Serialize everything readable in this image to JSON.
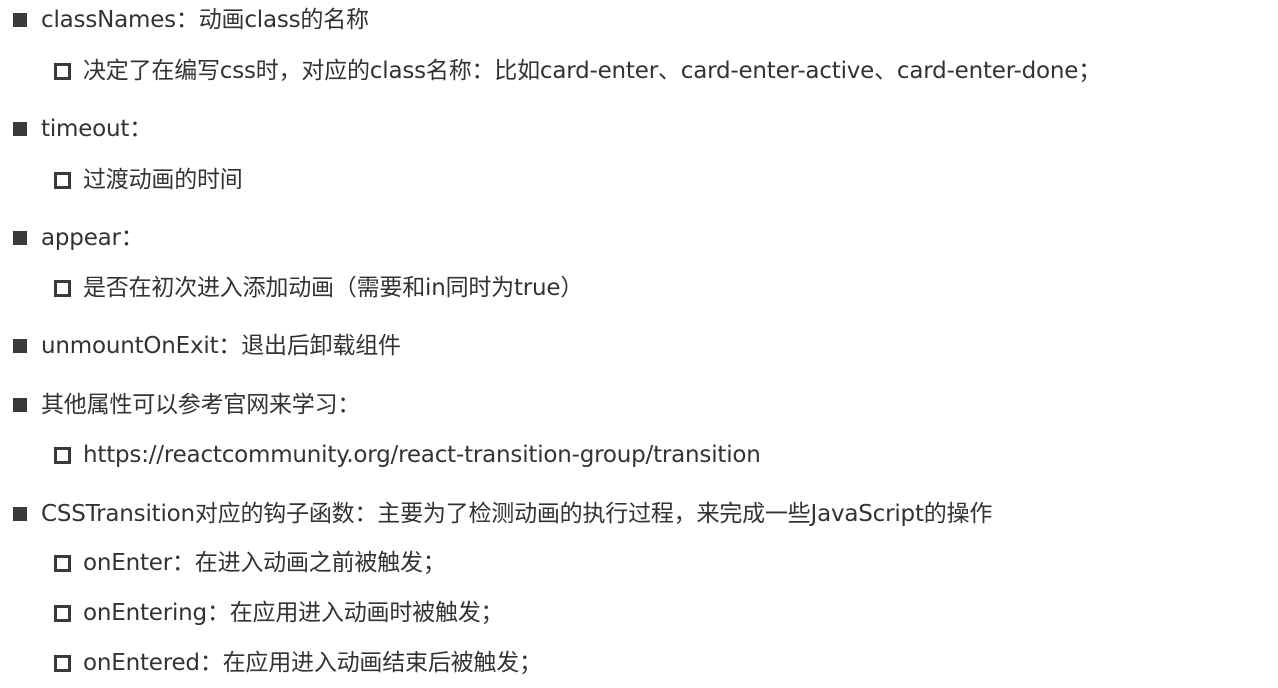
{
  "slide": {
    "items": [
      {
        "text": "classNames：动画class的名称",
        "children": [
          {
            "text": "决定了在编写css时，对应的class名称：比如card-enter、card-enter-active、card-enter-done；"
          }
        ]
      },
      {
        "text": "timeout：",
        "children": [
          {
            "text": "过渡动画的时间"
          }
        ]
      },
      {
        "text": "appear：",
        "children": [
          {
            "text": "是否在初次进入添加动画（需要和in同时为true）"
          }
        ]
      },
      {
        "text": "unmountOnExit：退出后卸载组件",
        "children": []
      },
      {
        "text": "其他属性可以参考官网来学习：",
        "children": [
          {
            "text": "https://reactcommunity.org/react-transition-group/transition"
          }
        ]
      },
      {
        "text": "CSSTransition对应的钩子函数：主要为了检测动画的执行过程，来完成一些JavaScript的操作",
        "children": [
          {
            "text": "onEnter：在进入动画之前被触发；"
          },
          {
            "text": "onEntering：在应用进入动画时被触发；"
          },
          {
            "text": "onEntered：在应用进入动画结束后被触发；"
          }
        ]
      }
    ]
  }
}
